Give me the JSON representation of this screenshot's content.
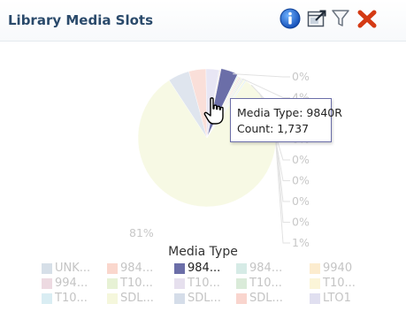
{
  "panel": {
    "title": "Library Media Slots"
  },
  "toolbar": {
    "info_icon": "info-icon",
    "export_icon": "export-icon",
    "filter_icon": "filter-icon",
    "close_icon": "close-icon",
    "info_color": "#1e73d8",
    "close_color": "#d43a14"
  },
  "tooltip": {
    "line1": "Media Type: 9840R",
    "line2": "Count: 1,737"
  },
  "chart_data": {
    "type": "pie",
    "legend_title": "Media Type",
    "legend_position": "bottom",
    "highlighted_slice": 2,
    "tooltip_value": 1737,
    "slice_labels": [
      "0%",
      "4%",
      "0%",
      "0%",
      "0%",
      "0%",
      "0%",
      "0%",
      "1%",
      "81%"
    ],
    "slices": [
      {
        "label": "UNK...",
        "color": "#9db3c7",
        "percent": 0.2
      },
      {
        "label": "984...",
        "color": "#f2a089",
        "percent": 0.2
      },
      {
        "label": "984...",
        "color": "#6b6ea8",
        "percent": 4.0
      },
      {
        "label": "984...",
        "color": "#9ed0c4",
        "percent": 0.3
      },
      {
        "label": "9940",
        "color": "#f7d28c",
        "percent": 0.3
      },
      {
        "label": "994...",
        "color": "#d5a6b8",
        "percent": 0.3
      },
      {
        "label": "T10...",
        "color": "#c5e09a",
        "percent": 0.3
      },
      {
        "label": "T10...",
        "color": "#c3b6d6",
        "percent": 0.3
      },
      {
        "label": "T10...",
        "color": "#a7cfa4",
        "percent": 0.3
      },
      {
        "label": "T10...",
        "color": "#f5e6a3",
        "percent": 0.3
      },
      {
        "label": "T10...",
        "color": "#a5d5e3",
        "percent": 0.3
      },
      {
        "label": "SDL...",
        "color": "#e7ecab",
        "percent": 81.0
      },
      {
        "label": "SDL...",
        "color": "#9aaecb",
        "percent": 5.0
      },
      {
        "label": "SDL...",
        "color": "#f09a8a",
        "percent": 4.0
      },
      {
        "label": "LTO1",
        "color": "#b6b2dc",
        "percent": 3.0
      }
    ]
  }
}
